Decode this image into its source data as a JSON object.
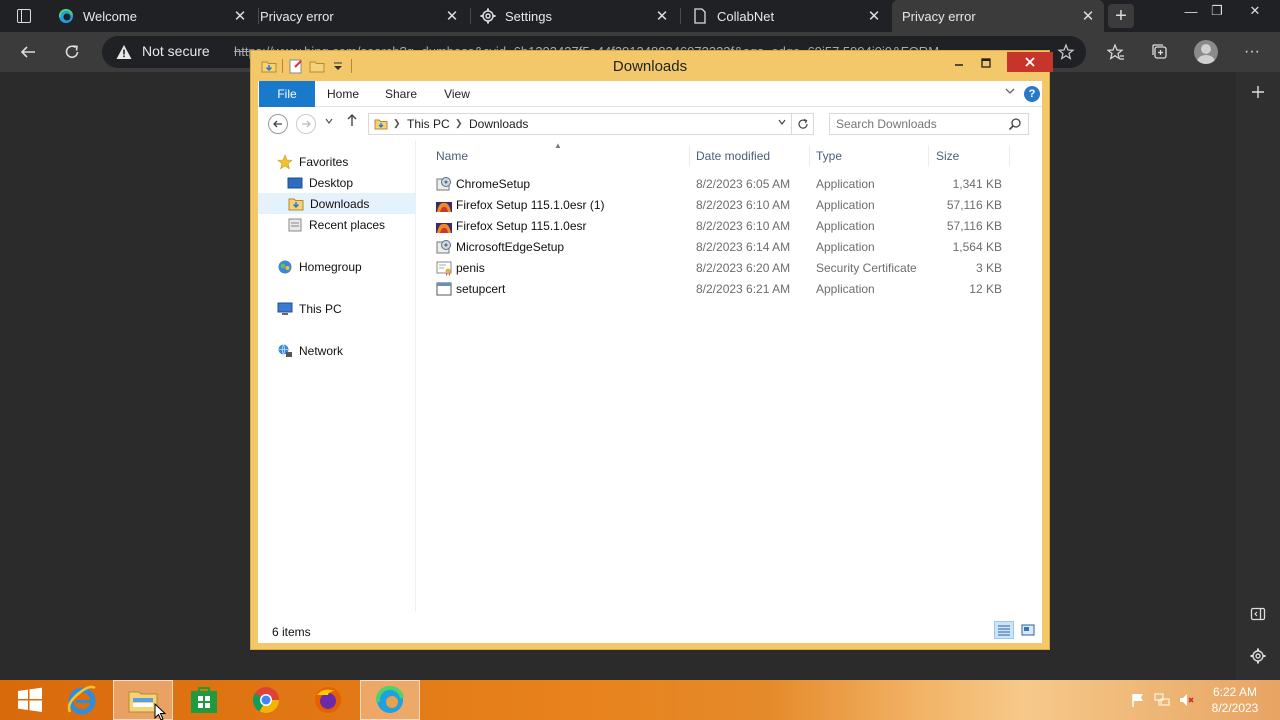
{
  "browser": {
    "tabs": [
      {
        "title": "Welcome",
        "icon": "edge-icon",
        "active": false
      },
      {
        "title": "Privacy error",
        "icon": "none",
        "active": false
      },
      {
        "title": "Settings",
        "icon": "gear-icon",
        "active": false
      },
      {
        "title": "CollabNet",
        "icon": "page-icon",
        "active": false
      },
      {
        "title": "Privacy error",
        "icon": "none",
        "active": true
      }
    ],
    "tab_close_glyph": "✕",
    "new_tab_glyph": "+",
    "address": {
      "security_label": "Not secure",
      "url": "https://www.bing.com/search?q=dumbass&cvid=6b1303437f5a44f2912488246073332f&aqs=edge..69i57.5994j0j9&FORM"
    },
    "window_controls": {
      "minimize": "—",
      "restore": "❐",
      "close": "✕"
    },
    "more_glyph": "···"
  },
  "explorer": {
    "title": "Downloads",
    "ribbon_tabs": [
      "File",
      "Home",
      "Share",
      "View"
    ],
    "help_glyph": "?",
    "breadcrumb": [
      "This PC",
      "Downloads"
    ],
    "search_placeholder": "Search Downloads",
    "nav": {
      "favorites": "Favorites",
      "desktop": "Desktop",
      "downloads": "Downloads",
      "recent": "Recent places",
      "homegroup": "Homegroup",
      "this_pc": "This PC",
      "network": "Network"
    },
    "columns": {
      "name": "Name",
      "date": "Date modified",
      "type": "Type",
      "size": "Size"
    },
    "files": [
      {
        "name": "ChromeSetup",
        "date": "8/2/2023 6:05 AM",
        "type": "Application",
        "size": "1,341 KB",
        "icon": "setup-icon"
      },
      {
        "name": "Firefox Setup 115.1.0esr (1)",
        "date": "8/2/2023 6:10 AM",
        "type": "Application",
        "size": "57,116 KB",
        "icon": "firefox-icon"
      },
      {
        "name": "Firefox Setup 115.1.0esr",
        "date": "8/2/2023 6:10 AM",
        "type": "Application",
        "size": "57,116 KB",
        "icon": "firefox-icon"
      },
      {
        "name": "MicrosoftEdgeSetup",
        "date": "8/2/2023 6:14 AM",
        "type": "Application",
        "size": "1,564 KB",
        "icon": "setup-icon"
      },
      {
        "name": "penis",
        "date": "8/2/2023 6:20 AM",
        "type": "Security Certificate",
        "size": "3 KB",
        "icon": "certificate-icon"
      },
      {
        "name": "setupcert",
        "date": "8/2/2023 6:21 AM",
        "type": "Application",
        "size": "12 KB",
        "icon": "app-window-icon"
      }
    ],
    "status": "6 items"
  },
  "taskbar": {
    "clock_time": "6:22 AM",
    "clock_date": "8/2/2023"
  },
  "colors": {
    "explorer_frame": "#f2c86a",
    "file_tab": "#1979ca",
    "close_red": "#c7342a",
    "taskbar_orange": "#e8821c"
  }
}
